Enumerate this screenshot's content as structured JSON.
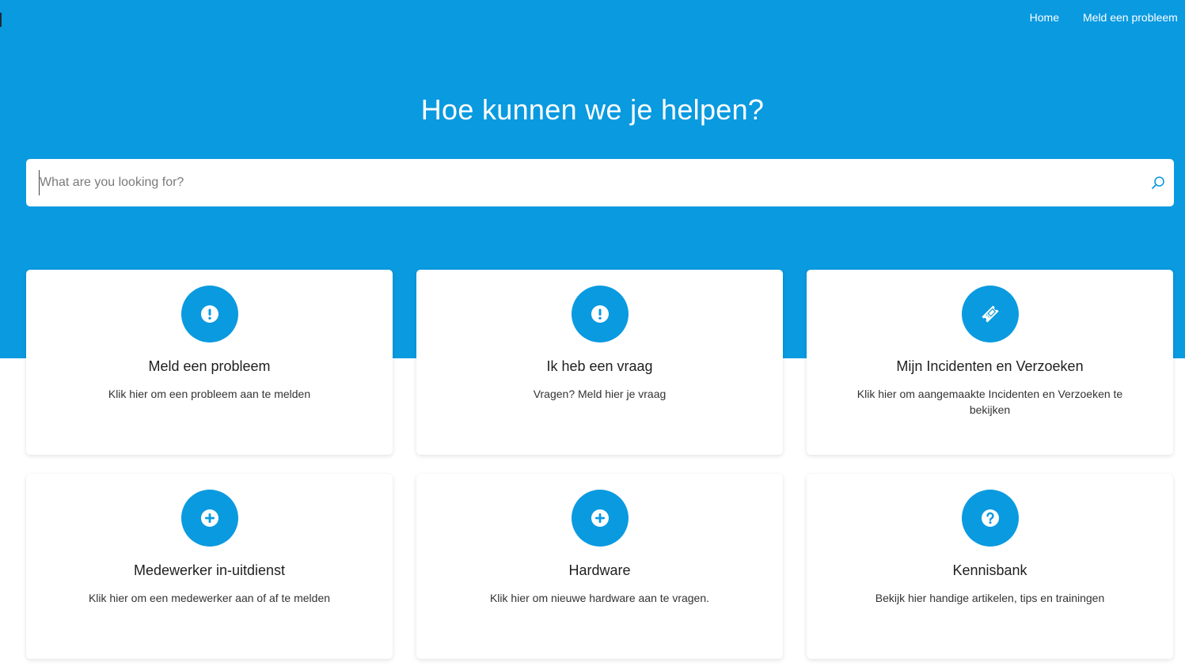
{
  "nav": {
    "home": "Home",
    "report": "Meld een probleem"
  },
  "hero": {
    "heading": "Hoe kunnen we je helpen?"
  },
  "search": {
    "placeholder": "What are you looking for?",
    "value": ""
  },
  "colors": {
    "brand": "#0a9ae0",
    "card_bg": "#ffffff"
  },
  "cards": [
    {
      "title": "Meld een probleem",
      "description": "Klik hier om een probleem aan te melden",
      "icon": "exclamation-icon"
    },
    {
      "title": "Ik heb een vraag",
      "description": "Vragen? Meld hier je vraag",
      "icon": "exclamation-icon"
    },
    {
      "title": "Mijn Incidenten en Verzoeken",
      "description": "Klik hier om aangemaakte Incidenten en Verzoeken te bekijken",
      "icon": "ticket-icon"
    },
    {
      "title": "Medewerker in-uitdienst",
      "description": "Klik hier om een medewerker aan of af te melden",
      "icon": "plus-icon"
    },
    {
      "title": "Hardware",
      "description": "Klik hier om nieuwe hardware aan te vragen.",
      "icon": "plus-icon"
    },
    {
      "title": "Kennisbank",
      "description": "Bekijk hier handige artikelen, tips en trainingen",
      "icon": "question-icon"
    }
  ]
}
